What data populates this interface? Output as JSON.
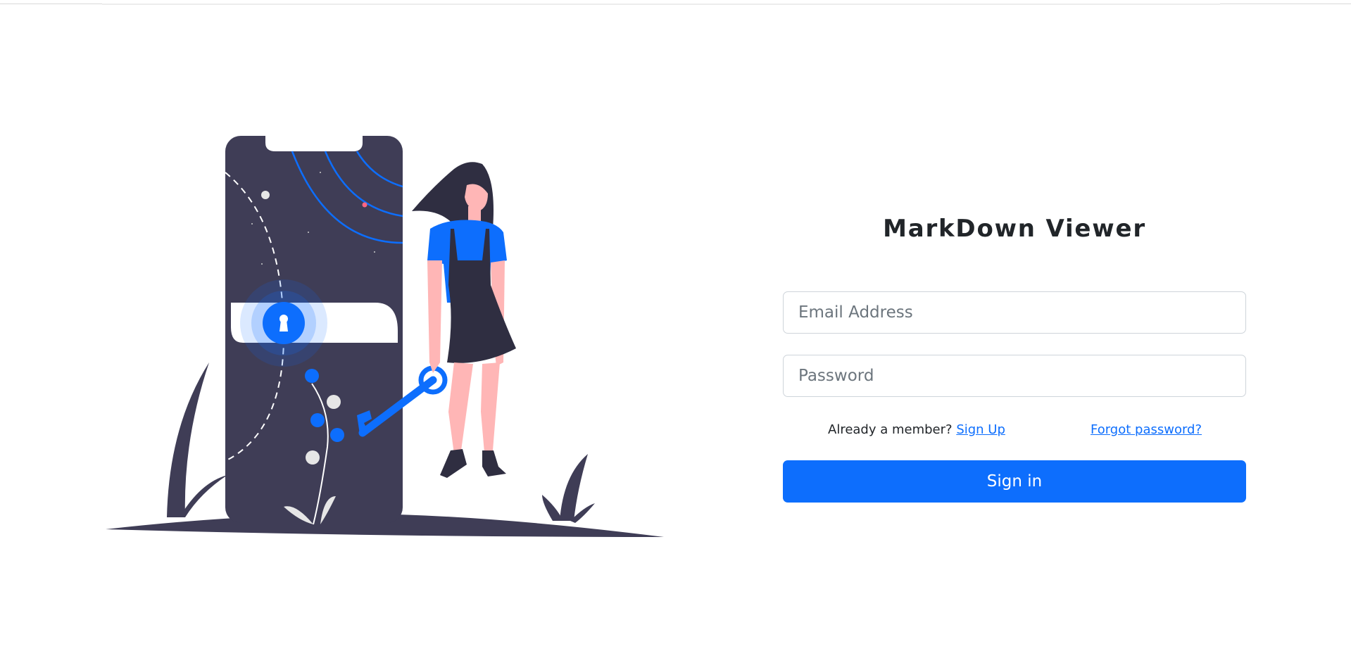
{
  "app": {
    "title": "MarkDown Viewer"
  },
  "form": {
    "email_placeholder": "Email Address",
    "email_value": "",
    "password_placeholder": "Password",
    "password_value": "",
    "member_prompt": "Already a member?",
    "signup_label": "Sign Up",
    "forgot_label": "Forgot password?",
    "signin_label": "Sign in"
  },
  "colors": {
    "accent": "#0d6efd",
    "illustration_dark": "#3f3d56",
    "skin": "#ffb6b6",
    "hair": "#2f2e41"
  },
  "icons": {
    "illustration": "phone-lock-key-illustration"
  }
}
